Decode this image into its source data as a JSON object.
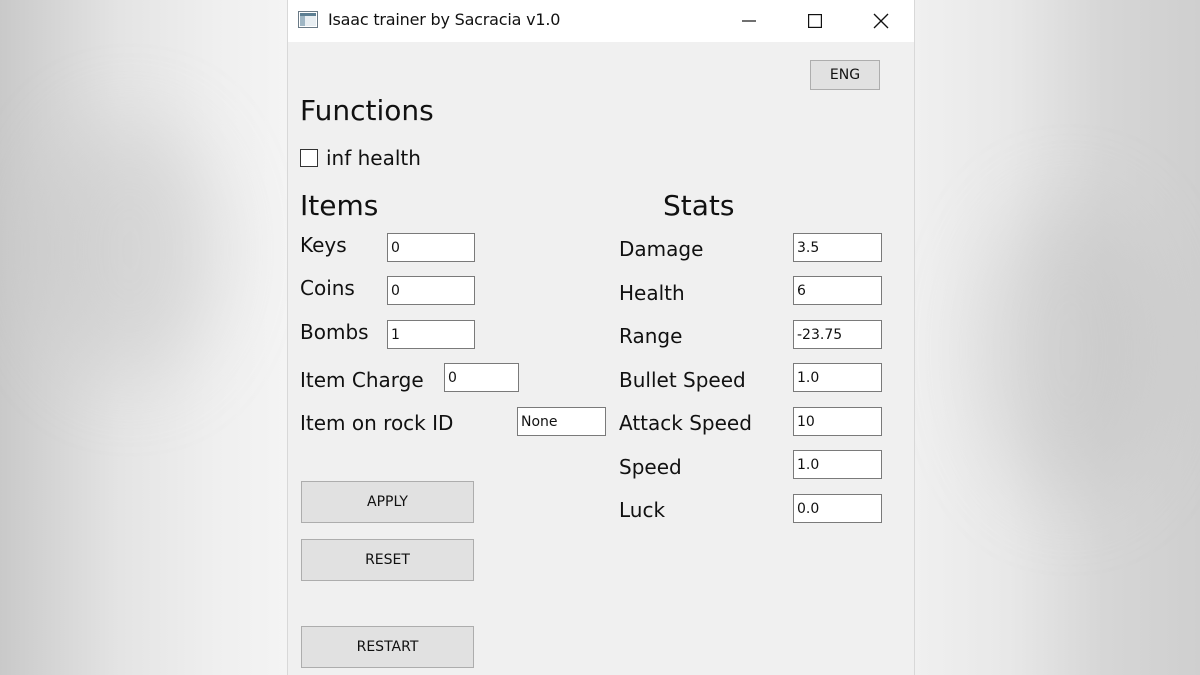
{
  "window": {
    "title": "Isaac trainer by Sacracia v1.0",
    "icons": {
      "app": "app-icon",
      "minimize": "minimize-icon",
      "maximize": "maximize-icon",
      "close": "close-icon"
    }
  },
  "language_button": "ENG",
  "functions": {
    "heading": "Functions",
    "inf_health": {
      "label": "inf health",
      "checked": false
    }
  },
  "items": {
    "heading": "Items",
    "fields": [
      {
        "label": "Keys",
        "value": "0"
      },
      {
        "label": "Coins",
        "value": "0"
      },
      {
        "label": "Bombs",
        "value": "1"
      },
      {
        "label": "Item Charge",
        "value": "0"
      },
      {
        "label": "Item on rock ID",
        "value": "None"
      }
    ]
  },
  "stats": {
    "heading": "Stats",
    "fields": [
      {
        "label": "Damage",
        "value": "3.5"
      },
      {
        "label": "Health",
        "value": "6"
      },
      {
        "label": "Range",
        "value": "-23.75"
      },
      {
        "label": "Bullet Speed",
        "value": "1.0"
      },
      {
        "label": "Attack Speed",
        "value": "10"
      },
      {
        "label": "Speed",
        "value": "1.0"
      },
      {
        "label": "Luck",
        "value": "0.0"
      }
    ]
  },
  "buttons": {
    "apply": "APPLY",
    "reset": "RESET",
    "restart": "RESTART"
  }
}
